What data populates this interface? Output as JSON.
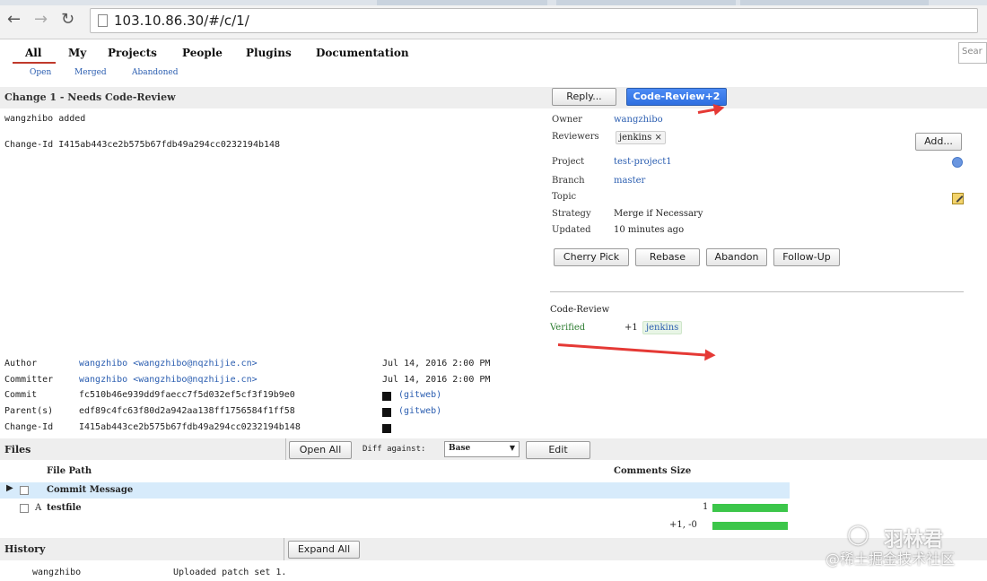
{
  "browser": {
    "url": "103.10.86.30/#/c/1/",
    "back_icon": "arrow-left-icon",
    "forward_icon": "arrow-right-icon",
    "reload_icon": "reload-icon"
  },
  "menu": {
    "items": [
      "All",
      "My",
      "Projects",
      "People",
      "Plugins",
      "Documentation"
    ],
    "sub_items": [
      "Open",
      "Merged",
      "Abandoned"
    ],
    "search_placeholder": "Sear"
  },
  "change": {
    "title": "Change 1 - Needs Code-Review",
    "message": "wangzhibo added",
    "change_id_line": "Change-Id  I415ab443ce2b575b67fdb49a294cc0232194b148",
    "reply_button": "Reply...",
    "code_review_button": "Code-Review+2"
  },
  "info": {
    "owner_label": "Owner",
    "owner": "wangzhibo",
    "reviewers_label": "Reviewers",
    "reviewer": "jenkins ×",
    "add_button": "Add...",
    "project_label": "Project",
    "project": "test-project1",
    "branch_label": "Branch",
    "branch": "master",
    "topic_label": "Topic",
    "strategy_label": "Strategy",
    "strategy": "Merge if Necessary",
    "updated_label": "Updated",
    "updated": "10 minutes ago",
    "actions": [
      "Cherry Pick",
      "Rebase",
      "Abandon",
      "Follow-Up"
    ]
  },
  "labels": {
    "code_review_label": "Code-Review",
    "verified_label": "Verified",
    "verified_score": "+1",
    "verified_by": "jenkins"
  },
  "commit": {
    "author_label": "Author",
    "author": "wangzhibo <wangzhibo@nqzhijie.cn>",
    "author_date": "Jul 14, 2016 2:00 PM",
    "committer_label": "Committer",
    "committer": "wangzhibo <wangzhibo@nqzhijie.cn>",
    "committer_date": "Jul 14, 2016 2:00 PM",
    "commit_label": "Commit",
    "commit": "fc510b46e939dd9faecc7f5d032ef5cf3f19b9e0",
    "commit_link": "(gitweb)",
    "parents_label": "Parent(s)",
    "parent": "edf89c4fc63f80d2a942aa138ff1756584f1ff58",
    "parent_link": "(gitweb)",
    "changeid_label": "Change-Id",
    "change_id": "I415ab443ce2b575b67fdb49a294cc0232194b148"
  },
  "files": {
    "title": "Files",
    "open_all_button": "Open All",
    "diff_against_label": "Diff against:",
    "diff_against_value": "Base",
    "edit_button": "Edit",
    "col_path": "File Path",
    "col_comments_size": "Comments Size",
    "rows": [
      {
        "status": "",
        "path": "Commit Message",
        "size": "1"
      },
      {
        "status": "A",
        "path": "testfile",
        "size": ""
      }
    ],
    "total": "+1, -0"
  },
  "history": {
    "title": "History",
    "expand_all_button": "Expand All",
    "author": "wangzhibo",
    "message": "Uploaded patch set 1."
  },
  "watermark": {
    "top": "羽林君",
    "bottom": "@稀土掘金技术社区"
  },
  "colors": {
    "accent_blue": "#2f6fe0",
    "link": "#2a5db0",
    "bar_green": "#3cc64a",
    "arrow_red": "#e53935"
  }
}
